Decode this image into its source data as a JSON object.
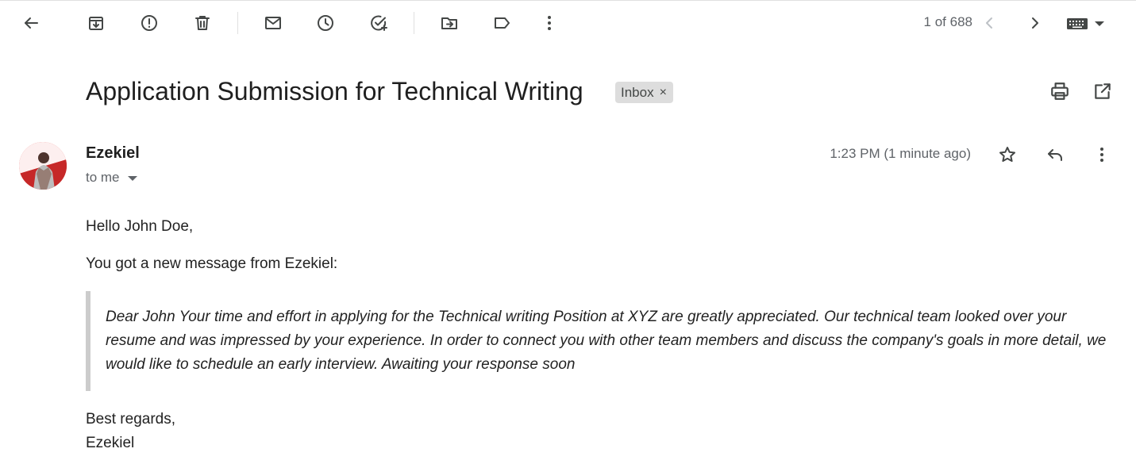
{
  "toolbar": {
    "buttons": [
      {
        "name": "back",
        "icon": "arrow-left-icon"
      },
      {
        "name": "archive",
        "icon": "archive-icon"
      },
      {
        "name": "report-spam",
        "icon": "report-spam-icon"
      },
      {
        "name": "delete",
        "icon": "trash-icon"
      },
      {
        "name": "mark-unread",
        "icon": "mail-icon"
      },
      {
        "name": "snooze",
        "icon": "clock-icon"
      },
      {
        "name": "add-to-tasks",
        "icon": "add-task-icon"
      },
      {
        "name": "move-to",
        "icon": "move-to-folder-icon"
      },
      {
        "name": "labels",
        "icon": "label-icon"
      },
      {
        "name": "more",
        "icon": "more-vertical-icon"
      }
    ],
    "pager": {
      "count": "1 of 688"
    }
  },
  "email": {
    "subject": "Application Submission for Technical Writing",
    "label_chip": "Inbox",
    "label_remove": "×",
    "sender": {
      "name": "Ezekiel",
      "recipient": "to me"
    },
    "timestamp": "1:23 PM (1 minute ago)",
    "body": {
      "greeting": "Hello John Doe,",
      "intro": "You got a new message from Ezekiel:",
      "quote": "Dear John Your time and effort in applying for the Technical writing Position at XYZ are greatly appreciated. Our technical team looked over your resume and was impressed by your experience. In order to connect you with other team members and discuss the company's goals in more detail, we would like to schedule an early interview. Awaiting your response soon",
      "signoff": "Best regards,",
      "signature": "Ezekiel"
    }
  },
  "colors": {
    "icon": "#444746",
    "muted_text": "#5f6368",
    "chip_bg": "#dddddd",
    "quote_border": "#cccccc",
    "avatar_red": "#e53935"
  }
}
